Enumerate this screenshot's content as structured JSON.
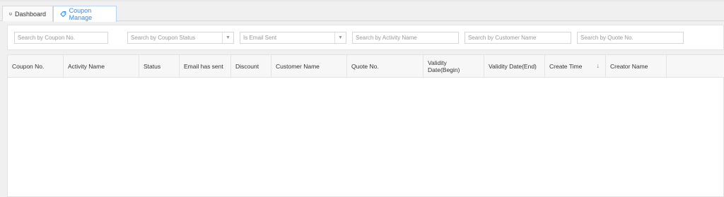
{
  "tabs": [
    {
      "label": "Dashboard",
      "icon": "monitor-icon"
    },
    {
      "label": "Coupon Manage",
      "icon": "tag-icon",
      "active": true
    }
  ],
  "filters": {
    "coupon_no": "Search by Coupon No.",
    "coupon_status": "Search by Coupon Status",
    "email_sent": "Is Email Sent",
    "activity_name": "Search by Activity Name",
    "customer_name": "Search by Customer Name",
    "quote_no": "Search by Quote No."
  },
  "table": {
    "columns": [
      "Coupon No.",
      "Activity Name",
      "Status",
      "Email has sent",
      "Discount",
      "Customer Name",
      "Quote No.",
      "Validity Date(Begin)",
      "Validity Date(End)",
      "Create Time",
      "Creator Name"
    ],
    "sort_column": "Create Time",
    "sort_direction": "desc",
    "rows": []
  },
  "colors": {
    "accent": "#2d8cf0"
  }
}
